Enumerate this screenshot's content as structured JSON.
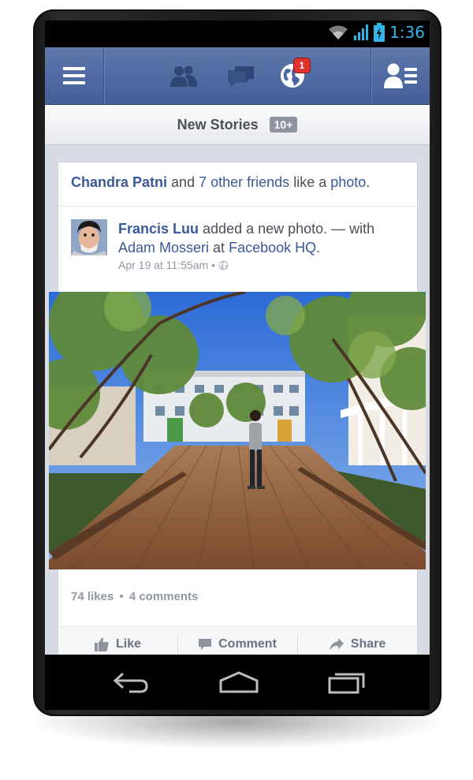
{
  "status_bar": {
    "time": "1:36"
  },
  "top_bar": {
    "menu_icon": "menu-icon",
    "friend_requests_icon": "friends-icon",
    "messages_icon": "messages-icon",
    "notifications_icon": "globe-icon",
    "notifications_count": "1",
    "chat_sidebar_icon": "contacts-icon"
  },
  "new_stories": {
    "label": "New Stories",
    "count": "10+"
  },
  "story": {
    "actor": "Chandra Patni",
    "connector": "and",
    "others": "7 other friends",
    "verb": "like a",
    "object": "photo",
    "end": "."
  },
  "post": {
    "author": "Francis Luu",
    "action": "added a new photo. — with",
    "tagged": "Adam Mosseri",
    "at": "at",
    "place": "Facebook HQ",
    "end": ".",
    "date": "Apr 19 at 11:55am",
    "separator": "•",
    "privacy_icon": "globe-icon"
  },
  "stats": {
    "likes": "74 likes",
    "dot": "•",
    "comments": "4 comments"
  },
  "actions": {
    "like": "Like",
    "comment": "Comment",
    "share": "Share"
  },
  "android_nav": {
    "back": "back-icon",
    "home": "home-icon",
    "recents": "recents-icon"
  },
  "colors": {
    "brand": "#3b5998",
    "topbar": "#4c66a4",
    "time": "#34b5e5",
    "badge": "#e0312d"
  }
}
